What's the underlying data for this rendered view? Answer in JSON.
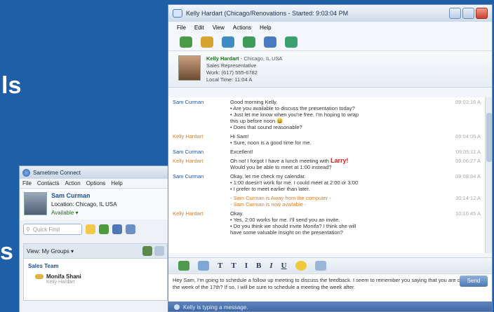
{
  "background": {
    "text_left": "ls",
    "text_left2": "s"
  },
  "connect": {
    "title": "Sametime Connect",
    "menu": [
      "File",
      "Contacts",
      "Action",
      "Options",
      "Help"
    ],
    "user": {
      "name": "Sam Curman",
      "location": "Location: Chicago, IL USA",
      "status": "Available ▾"
    },
    "find_placeholder": "Quick Find",
    "view_label": "View: My Groups ▾",
    "group": "Sales Team",
    "contact": "Monifa Shani",
    "contact_sub": "Kelly Hardart"
  },
  "chat": {
    "title": "Kelly Hardart (Chicago/Renovations - Started: 9:03:04 PM",
    "menu": [
      "File",
      "Edit",
      "View",
      "Actions",
      "Help"
    ],
    "header": {
      "name": "Kelly Hardart",
      "location": " - Chicago, IL USA",
      "role": "Sales Representative",
      "work": "Work: (617) 555-6782",
      "local_time": "Local Time: 11:04 A"
    },
    "messages": [
      {
        "speaker": "Sam Curman",
        "who": "sam",
        "lines": [
          "Good morning Kelly.",
          "• Are you available to discuss the presentation today?",
          "• Just let me know when you're free. I'm hoping to wrap",
          "  this up before noon 😀",
          "• Does that sound reasonable?"
        ],
        "time": "09:03:16 A"
      },
      {
        "speaker": "Kelly Hardart",
        "who": "kelly",
        "lines": [
          "Hi Sam!",
          "• Sure, noon is a good time for me."
        ],
        "time": "09:04:05 A"
      },
      {
        "speaker": "Sam Curman",
        "who": "sam",
        "lines": [
          "Excellent!"
        ],
        "time": "09:05:11 A"
      },
      {
        "speaker": "Kelly Hardart",
        "who": "kelly",
        "lines": [
          "Oh no! I forgot I have a lunch meeting with",
          "Would you be able to meet at 1:00 instead?"
        ],
        "highlight": "Larry!",
        "time": "09:06:27 A"
      },
      {
        "speaker": "Sam Curman",
        "who": "sam",
        "lines": [
          "Okay, let me check my calendar.",
          "• 1:00 doesn't work for me. I could meet at 2:00 or 3:00",
          "• I prefer to meet earlier than later."
        ],
        "time": "09:08:04 A"
      },
      {
        "speaker": "",
        "who": "notice",
        "lines": [
          "- Sam Curman is Away from the computer -",
          "- Sam Curman is now available -"
        ],
        "time": "10:14:12 A"
      },
      {
        "speaker": "Kelly Hardart",
        "who": "kelly",
        "lines": [
          "Okay.",
          "• Yes, 2:00 works for me. I'll send you an invite.",
          "• Do you think we should invite Monifa? I think she will",
          "  have some valuable insight on the presentation?"
        ],
        "time": "10:16:45 A"
      }
    ],
    "format_labels": [
      "T",
      "T",
      "I",
      "B",
      "I",
      "U"
    ],
    "input_text": "Hey Sam, I'm going to schedule a follow up meeting to discuss the feedback. I seem to remember you saying that you are on vacation the week of the 17th? If so, I will be sure to schedule a meeting the week after.",
    "send_label": "Send",
    "status_text": "Kelly is typing a message."
  }
}
